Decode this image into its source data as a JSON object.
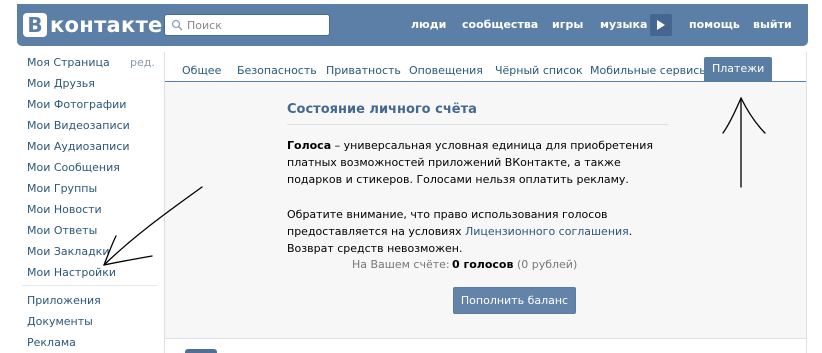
{
  "header": {
    "logo_letter": "B",
    "logo_text": "контакте",
    "search": {
      "placeholder": "Поиск",
      "icon": "search-icon"
    },
    "nav": [
      "люди",
      "сообщества",
      "игры",
      "музыка",
      "помощь",
      "выйти"
    ],
    "player_icon": "play-icon"
  },
  "sidebar": {
    "edit_label": "ред.",
    "items": [
      "Моя Страница",
      "Мои Друзья",
      "Мои Фотографии",
      "Мои Видеозаписи",
      "Мои Аудиозаписи",
      "Мои Сообщения",
      "Мои Группы",
      "Мои Новости",
      "Мои Ответы",
      "Мои Закладки",
      "Мои Настройки"
    ],
    "extra": [
      "Приложения",
      "Документы",
      "Реклама"
    ]
  },
  "tabs": {
    "items": [
      "Общее",
      "Безопасность",
      "Приватность",
      "Оповещения",
      "Чёрный список",
      "Мобильные сервисы"
    ],
    "active": "Платежи"
  },
  "account": {
    "title": "Состояние личного счёта",
    "para1_bold": "Голоса",
    "para1_rest": " – универсальная условная единица для приобретения платных возможностей приложений ВКонтакте, а также подарков и стикеров. Голосами нельзя оплатить рекламу.",
    "para2_start": "Обратите внимание, что право использования голосов предоставляется на условиях ",
    "para2_link": "Лицензионного соглашения",
    "para2_end": ". Возврат средств невозможен.",
    "balance_label": "На Вашем счёте:",
    "balance_votes": "0 голосов",
    "balance_rub": " (0 рублей)",
    "topup_button": "Пополнить баланс"
  },
  "colors": {
    "header_bg": "#5b7fa6",
    "link": "#2b587a",
    "accent": "#597da3",
    "button": "#6383a8"
  }
}
